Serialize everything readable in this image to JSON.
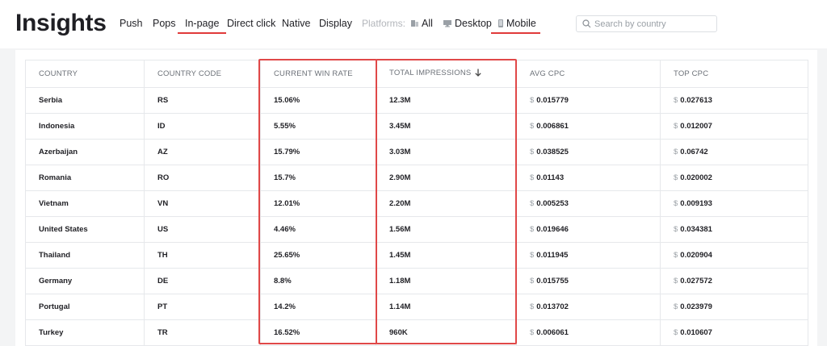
{
  "header": {
    "title": "Insights",
    "tabs": [
      {
        "label": "Push"
      },
      {
        "label": "Pops"
      },
      {
        "label": "In-page"
      },
      {
        "label": "Direct click"
      },
      {
        "label": "Native"
      },
      {
        "label": "Display"
      }
    ],
    "active_tab": "In-page",
    "platforms_label": "Platforms:",
    "platforms": [
      {
        "label": "All",
        "icon": "all-devices-icon"
      },
      {
        "label": "Desktop",
        "icon": "desktop-icon"
      },
      {
        "label": "Mobile",
        "icon": "mobile-icon"
      }
    ],
    "active_platform": "Mobile",
    "search": {
      "placeholder": "Search by country",
      "value": ""
    }
  },
  "table": {
    "columns": [
      "COUNTRY",
      "COUNTRY CODE",
      "CURRENT WIN RATE",
      "TOTAL IMPRESSIONS",
      "AVG CPC",
      "TOP CPC"
    ],
    "sorted_by": "TOTAL IMPRESSIONS",
    "sort_direction": "descending",
    "currency_symbol": "$",
    "rows": [
      {
        "country": "Serbia",
        "code": "RS",
        "win_rate": "15.06%",
        "impressions": "12.3M",
        "avg_cpc": "0.015779",
        "top_cpc": "0.027613"
      },
      {
        "country": "Indonesia",
        "code": "ID",
        "win_rate": "5.55%",
        "impressions": "3.45M",
        "avg_cpc": "0.006861",
        "top_cpc": "0.012007"
      },
      {
        "country": "Azerbaijan",
        "code": "AZ",
        "win_rate": "15.79%",
        "impressions": "3.03M",
        "avg_cpc": "0.038525",
        "top_cpc": "0.06742"
      },
      {
        "country": "Romania",
        "code": "RO",
        "win_rate": "15.7%",
        "impressions": "2.90M",
        "avg_cpc": "0.01143",
        "top_cpc": "0.020002"
      },
      {
        "country": "Vietnam",
        "code": "VN",
        "win_rate": "12.01%",
        "impressions": "2.20M",
        "avg_cpc": "0.005253",
        "top_cpc": "0.009193"
      },
      {
        "country": "United States",
        "code": "US",
        "win_rate": "4.46%",
        "impressions": "1.56M",
        "avg_cpc": "0.019646",
        "top_cpc": "0.034381"
      },
      {
        "country": "Thailand",
        "code": "TH",
        "win_rate": "25.65%",
        "impressions": "1.45M",
        "avg_cpc": "0.011945",
        "top_cpc": "0.020904"
      },
      {
        "country": "Germany",
        "code": "DE",
        "win_rate": "8.8%",
        "impressions": "1.18M",
        "avg_cpc": "0.015755",
        "top_cpc": "0.027572"
      },
      {
        "country": "Portugal",
        "code": "PT",
        "win_rate": "14.2%",
        "impressions": "1.14M",
        "avg_cpc": "0.013702",
        "top_cpc": "0.023979"
      },
      {
        "country": "Turkey",
        "code": "TR",
        "win_rate": "16.52%",
        "impressions": "960K",
        "avg_cpc": "0.006061",
        "top_cpc": "0.010607"
      }
    ]
  },
  "colors": {
    "accent": "#e03a3a",
    "highlight_border": "#e04848",
    "muted_text": "#6c7178"
  }
}
